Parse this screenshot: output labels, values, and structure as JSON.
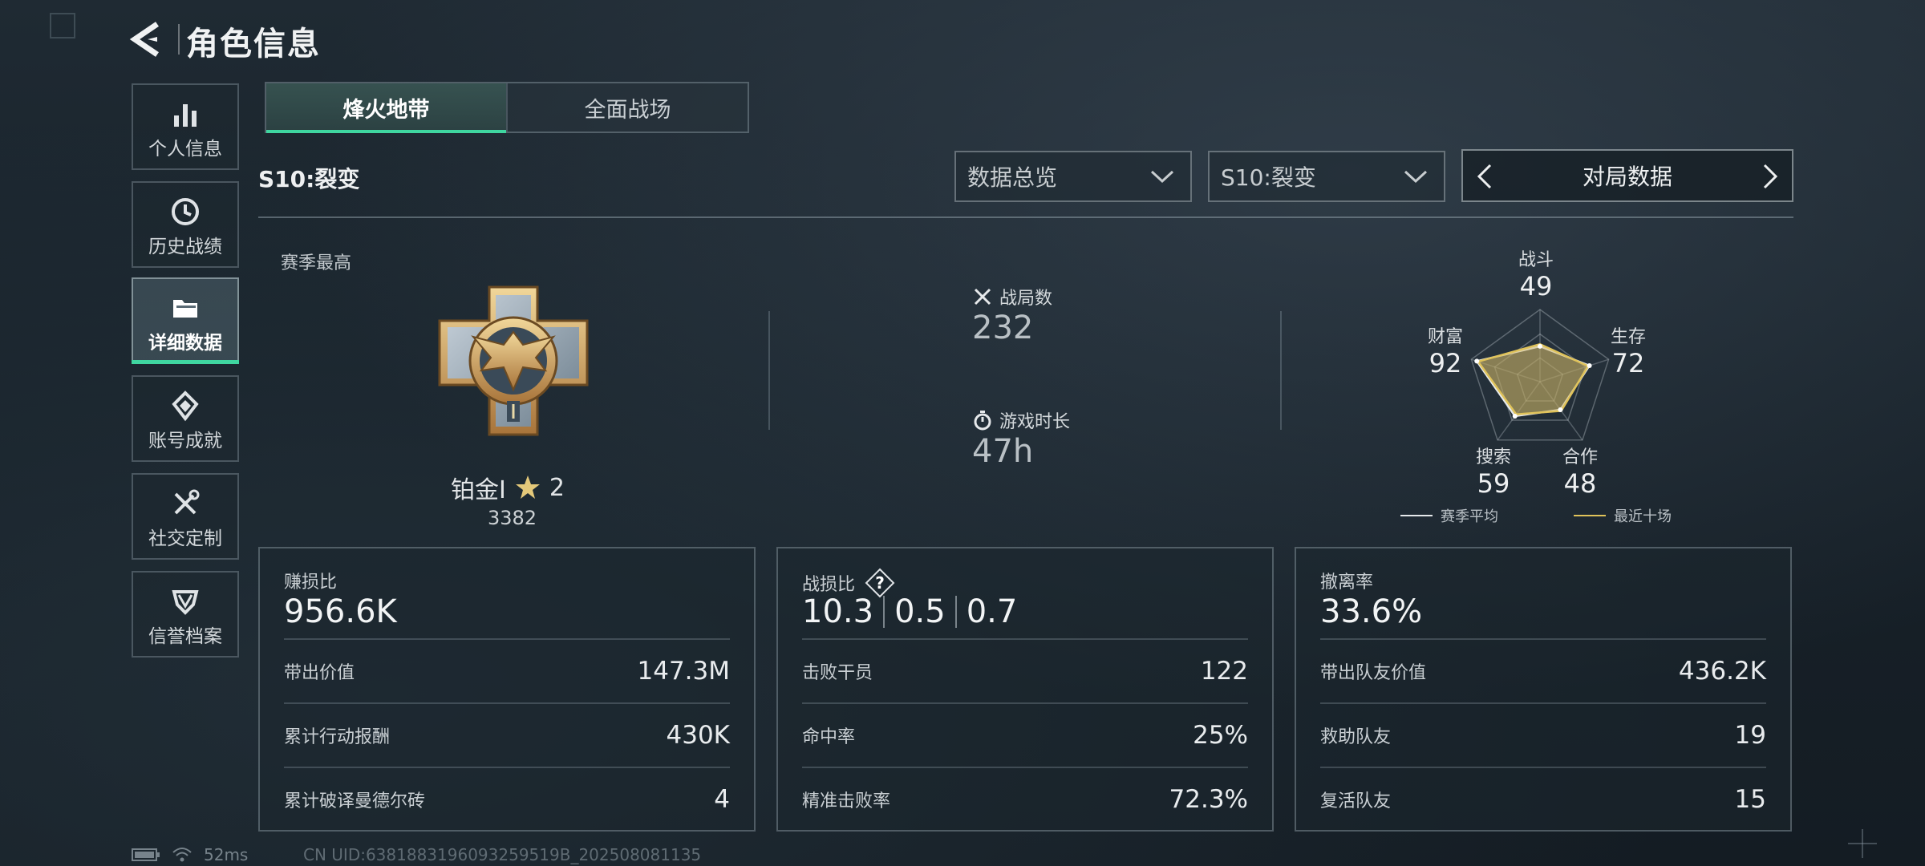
{
  "header": {
    "title": "角色信息"
  },
  "sidebar": {
    "items": [
      {
        "label": "个人信息",
        "icon": "bar-chart-icon",
        "active": false
      },
      {
        "label": "历史战绩",
        "icon": "clock-icon",
        "active": false
      },
      {
        "label": "详细数据",
        "icon": "folder-icon",
        "active": true
      },
      {
        "label": "账号成就",
        "icon": "medal-icon",
        "active": false
      },
      {
        "label": "社交定制",
        "icon": "tools-icon",
        "active": false
      },
      {
        "label": "信誉档案",
        "icon": "shield-badge-icon",
        "active": false
      }
    ]
  },
  "mode_tabs": [
    {
      "label": "烽火地带",
      "active": true
    },
    {
      "label": "全面战场",
      "active": false
    }
  ],
  "season_title": "S10:裂变",
  "filters": {
    "data_view": "数据总览",
    "season": "S10:裂变",
    "pager_label": "对局数据"
  },
  "overview": {
    "season_best_label": "赛季最高",
    "rank_name": "铂金Ⅰ",
    "rank_stars": "2",
    "rank_score": "3382",
    "matches_label": "战局数",
    "matches_value": "232",
    "playtime_label": "游戏时长",
    "playtime_value": "47h"
  },
  "radar": {
    "axes": [
      {
        "label": "战斗",
        "value": "49",
        "season_avg": 0.49,
        "recent": 0.52
      },
      {
        "label": "生存",
        "value": "72",
        "season_avg": 0.72,
        "recent": 0.7
      },
      {
        "label": "合作",
        "value": "48",
        "season_avg": 0.48,
        "recent": 0.5
      },
      {
        "label": "搜索",
        "value": "59",
        "season_avg": 0.59,
        "recent": 0.56
      },
      {
        "label": "财富",
        "value": "92",
        "season_avg": 0.92,
        "recent": 0.9
      }
    ],
    "legend_season_avg": "赛季平均",
    "legend_recent": "最近十场",
    "color_season_avg": "#e6e9eb",
    "color_recent": "#e0c35a"
  },
  "cards": {
    "profit": {
      "label": "赚损比",
      "value": "956.6K",
      "rows": [
        {
          "k": "带出价值",
          "v": "147.3M"
        },
        {
          "k": "累计行动报酬",
          "v": "430K"
        },
        {
          "k": "累计破译曼德尔砖",
          "v": "4"
        }
      ]
    },
    "kd": {
      "label": "战损比",
      "values": [
        "10.3",
        "0.5",
        "0.7"
      ],
      "rows": [
        {
          "k": "击败干员",
          "v": "122"
        },
        {
          "k": "命中率",
          "v": "25%"
        },
        {
          "k": "精准击败率",
          "v": "72.3%"
        }
      ]
    },
    "extract": {
      "label": "撤离率",
      "value": "33.6%",
      "rows": [
        {
          "k": "带出队友价值",
          "v": "436.2K"
        },
        {
          "k": "救助队友",
          "v": "19"
        },
        {
          "k": "复活队友",
          "v": "15"
        }
      ]
    }
  },
  "status_bar": {
    "ping": "52ms",
    "uid": "CN UID:6381883196093259519B_202508081135"
  }
}
